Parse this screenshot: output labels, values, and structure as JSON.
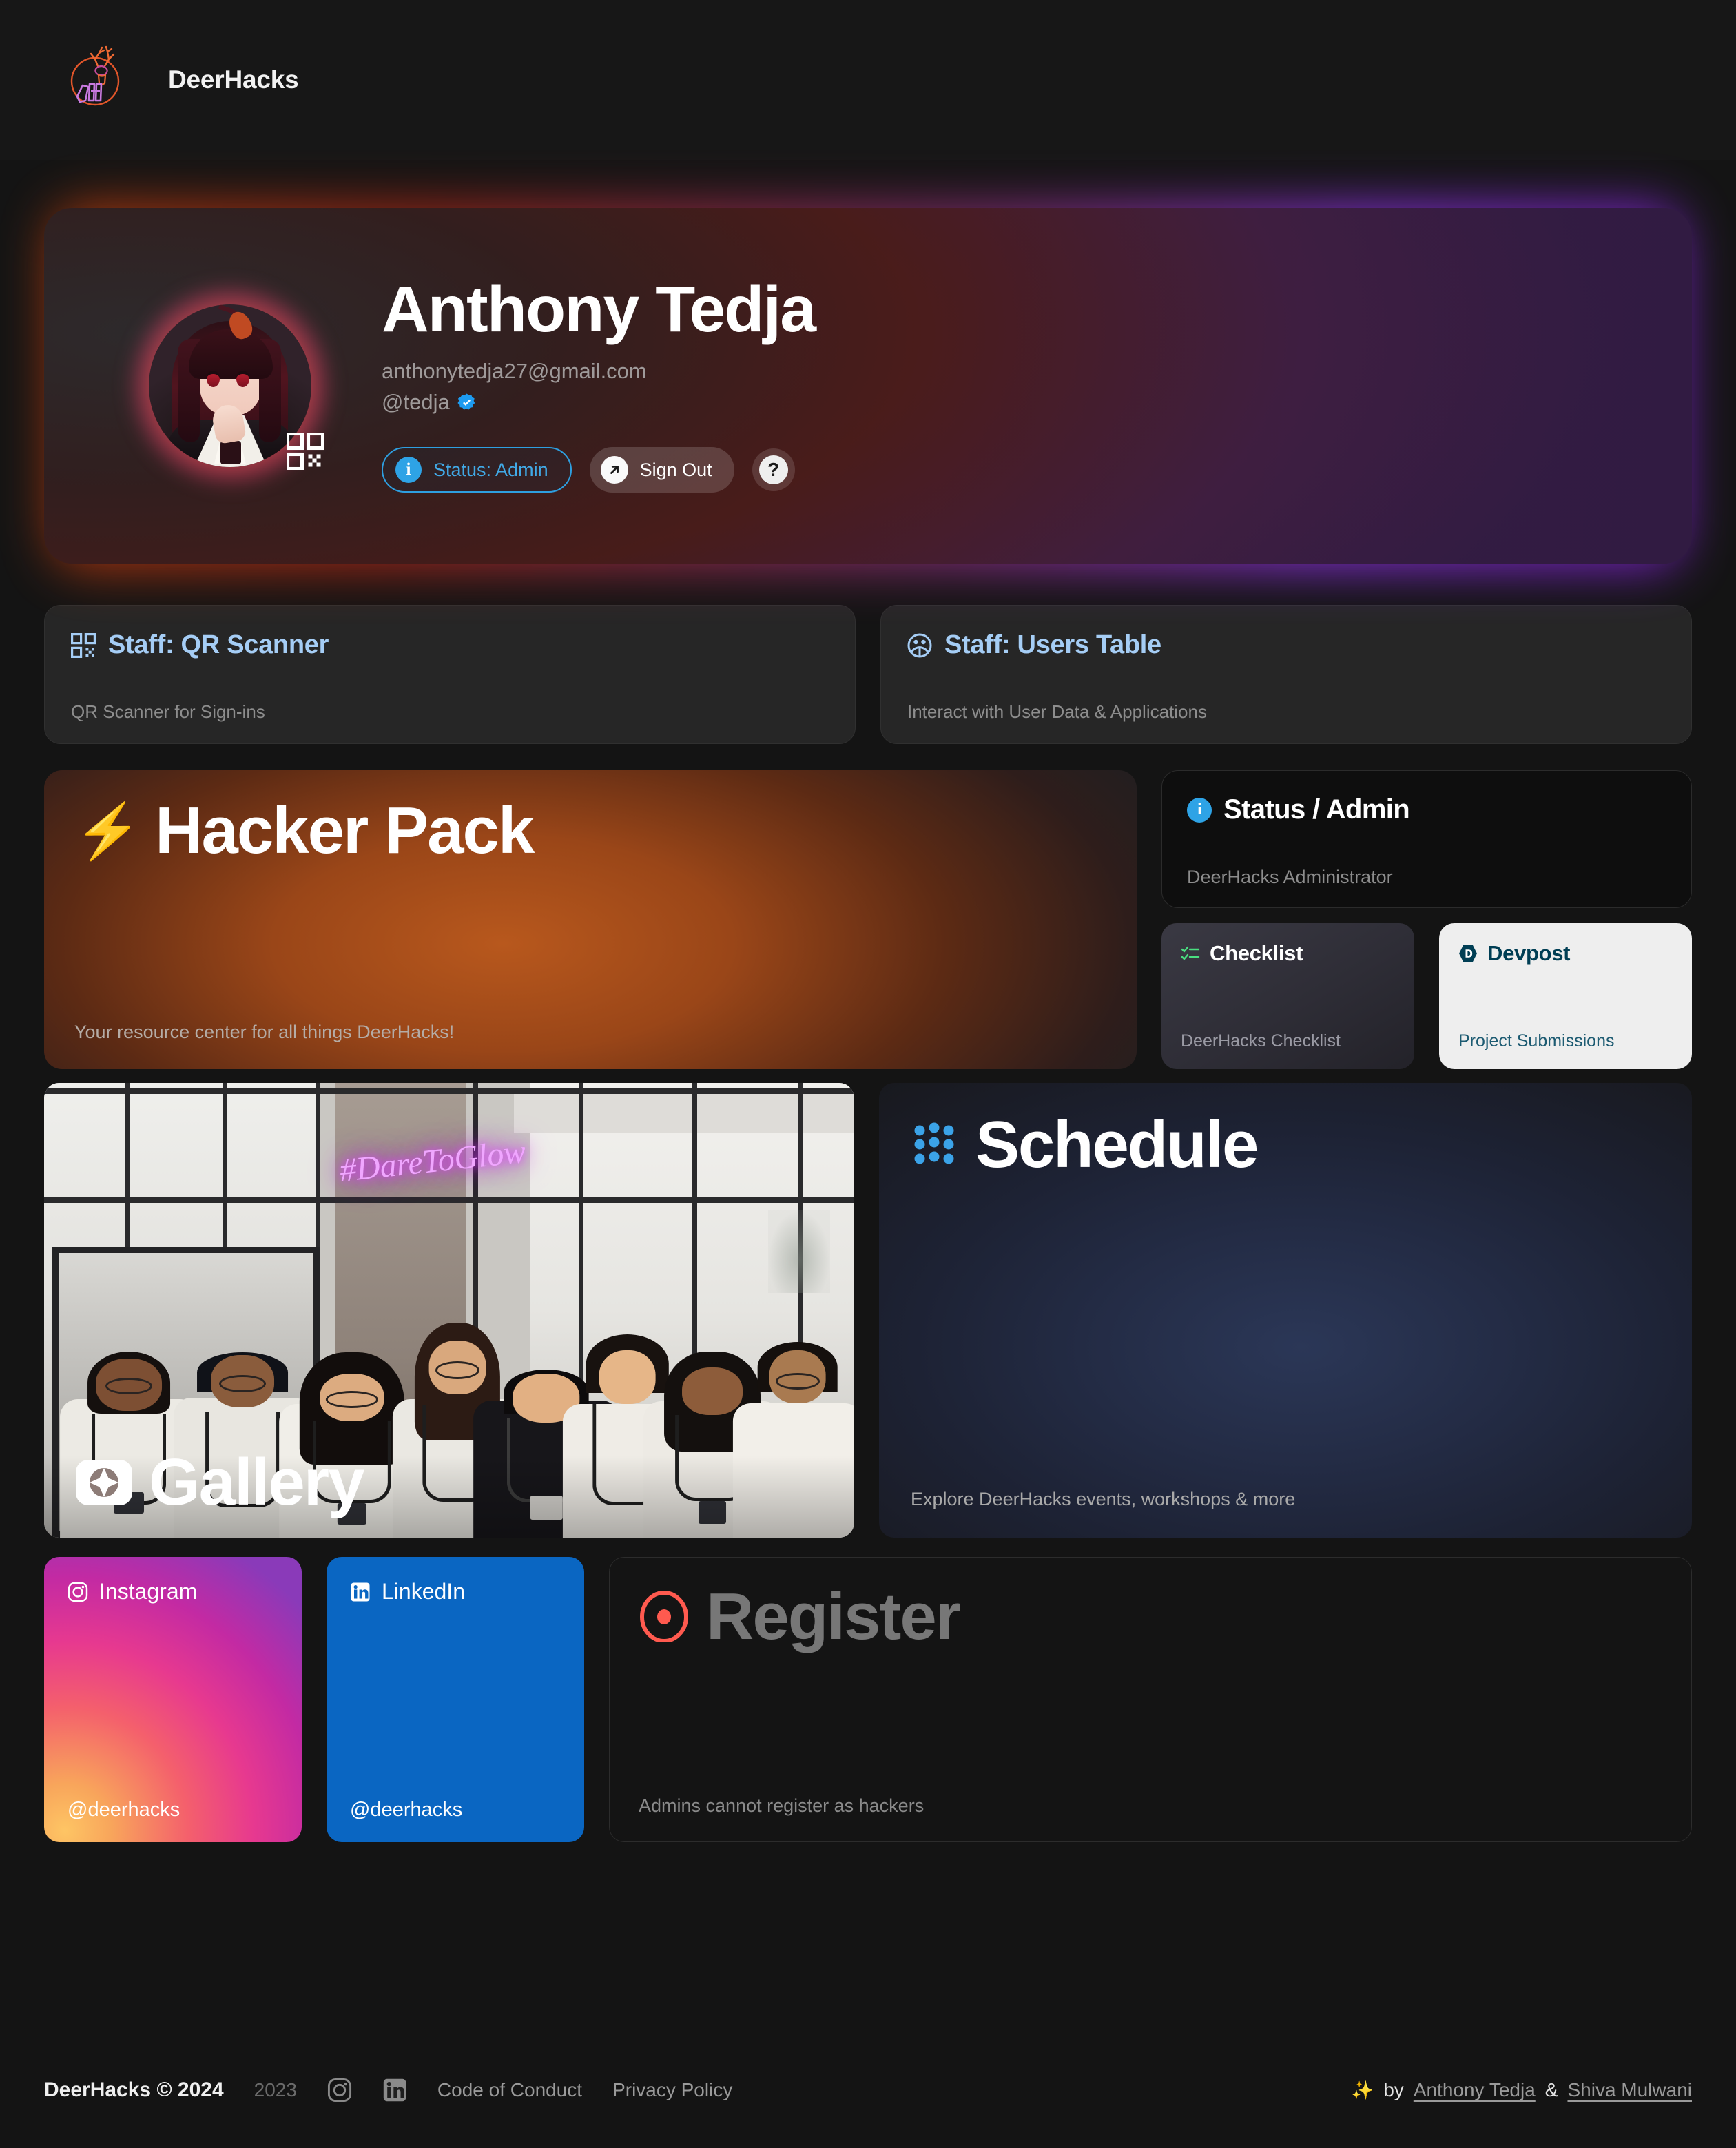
{
  "nav": {
    "logo_icon": "deerhacks-neon-deer-logo",
    "title": "DeerHacks"
  },
  "profile": {
    "avatar_icon": "user-avatar-anime",
    "qr_badge_icon": "qr-code-icon",
    "name": "Anthony Tedja",
    "email": "anthonytedja27@gmail.com",
    "handle": "@tedja",
    "verified_icon": "verified-check-badge",
    "status_button": {
      "label": "Status: Admin",
      "icon": "info-circle-icon",
      "accent": "#2ea3e6"
    },
    "signout_button": {
      "label": "Sign Out",
      "icon": "arrow-up-right-icon"
    },
    "help_button": {
      "label": "?",
      "icon": "question-mark-icon"
    }
  },
  "staff_cards": [
    {
      "title": "Staff: QR Scanner",
      "subtitle": "QR Scanner for Sign-ins",
      "icon": "qr-code-icon",
      "accent": "#a5cdf5"
    },
    {
      "title": "Staff: Users Table",
      "subtitle": "Interact with User Data & Applications",
      "icon": "users-group-icon",
      "accent": "#a5cdf5"
    }
  ],
  "hacker_pack": {
    "title": "Hacker Pack",
    "icon": "lightning-bolt-emoji",
    "icon_glyph": "⚡",
    "subtitle": "Your resource center for all things DeerHacks!"
  },
  "status_card": {
    "title": "Status / Admin",
    "subtitle": "DeerHacks Administrator",
    "icon": "info-circle-icon",
    "accent": "#2ea3e6"
  },
  "checklist_card": {
    "title": "Checklist",
    "subtitle": "DeerHacks Checklist",
    "icon": "checklist-icon",
    "accent": "#4ade80"
  },
  "devpost_card": {
    "title": "Devpost",
    "subtitle": "Project Submissions",
    "icon": "devpost-logo-icon",
    "accent": "#003e54",
    "background": "#eeeeee"
  },
  "gallery_card": {
    "title": "Gallery",
    "icon": "google-photos-icon",
    "photo_caption": "DeerHacks team group photo",
    "neon_sign_text": "#DareToGlow"
  },
  "schedule_card": {
    "title": "Schedule",
    "icon": "notion-dots-icon",
    "subtitle": "Explore DeerHacks events, workshops & more",
    "accent": "#3ba3e8"
  },
  "social_cards": [
    {
      "name": "Instagram",
      "handle": "@deerhacks",
      "icon": "instagram-icon"
    },
    {
      "name": "LinkedIn",
      "handle": "@deerhacks",
      "icon": "linkedin-icon",
      "background": "#0a66c2"
    }
  ],
  "register_card": {
    "title": "Register",
    "subtitle": "Admins cannot register as hackers",
    "icon": "record-circle-icon",
    "accent": "#ff5a4f",
    "disabled": true
  },
  "footer": {
    "brand": "DeerHacks © 2024",
    "year_link": "2023",
    "instagram_icon": "instagram-icon",
    "linkedin_icon": "linkedin-icon",
    "links": [
      "Code of Conduct",
      "Privacy Policy"
    ],
    "credit_spark": "✨",
    "credit_by": "by",
    "credit_author_1": "Anthony Tedja",
    "credit_amp": "&",
    "credit_author_2": "Shiva Mulwani"
  }
}
